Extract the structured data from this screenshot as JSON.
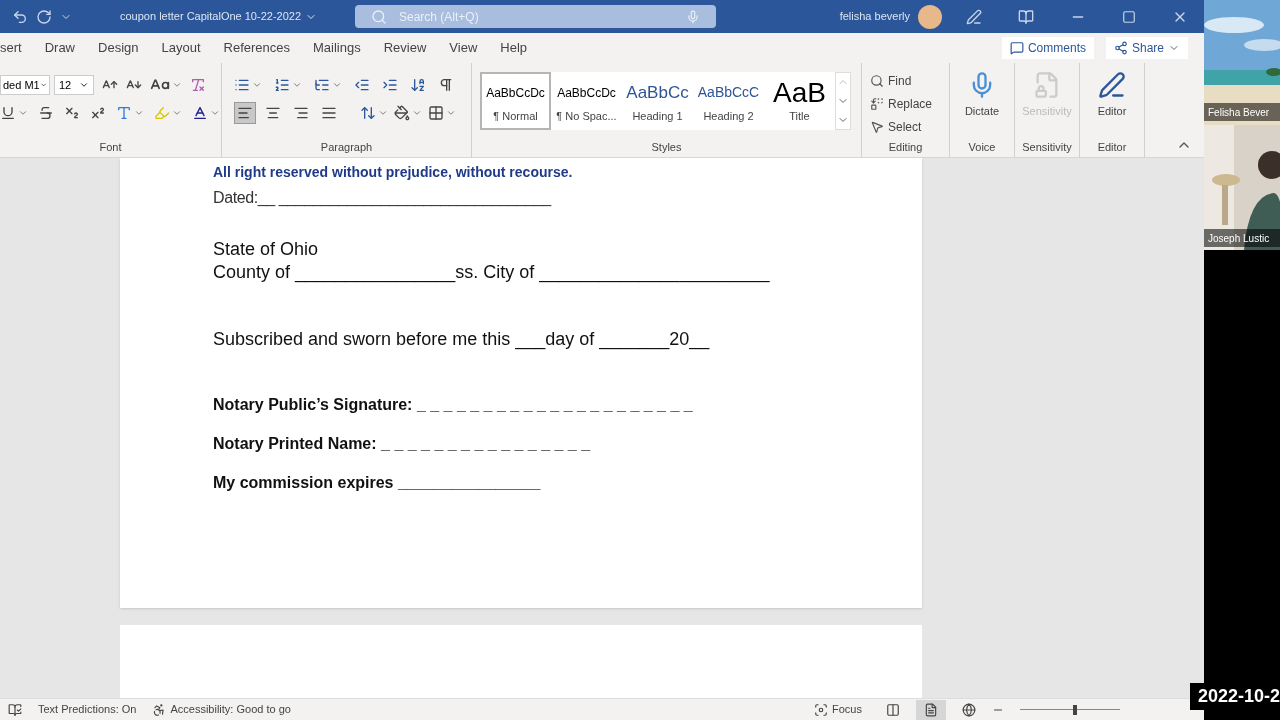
{
  "title_bar": {
    "document_title": "coupon letter CapitalOne 10-22-2022",
    "search_placeholder": "Search (Alt+Q)",
    "user_name": "felisha beverly"
  },
  "ribbon_tabs": [
    {
      "label": "sert",
      "selected": false
    },
    {
      "label": "Draw",
      "selected": false
    },
    {
      "label": "Design",
      "selected": false
    },
    {
      "label": "Layout",
      "selected": false
    },
    {
      "label": "References",
      "selected": false
    },
    {
      "label": "Mailings",
      "selected": false
    },
    {
      "label": "Review",
      "selected": false
    },
    {
      "label": "View",
      "selected": false
    },
    {
      "label": "Help",
      "selected": false
    }
  ],
  "comments_button": "Comments",
  "share_button": "Share",
  "font_group": {
    "font_name": "ded M1",
    "font_size": "12",
    "label": "Font"
  },
  "paragraph_group": {
    "label": "Paragraph",
    "alignments": [
      {
        "kind": "left",
        "selected": true
      },
      {
        "kind": "center",
        "selected": false
      },
      {
        "kind": "right",
        "selected": false
      },
      {
        "kind": "justify",
        "selected": false
      }
    ]
  },
  "styles_group": {
    "label": "Styles",
    "styles": [
      {
        "preview": "AaBbCcDc",
        "name": "¶ Normal",
        "kind": "normal",
        "selected": true
      },
      {
        "preview": "AaBbCcDc",
        "name": "¶ No Spac...",
        "kind": "normal",
        "selected": false
      },
      {
        "preview": "AaBbCc",
        "name": "Heading 1",
        "kind": "heading1",
        "selected": false
      },
      {
        "preview": "AaBbCcC",
        "name": "Heading 2",
        "kind": "heading2",
        "selected": false
      },
      {
        "preview": "AaB",
        "name": "Title",
        "kind": "title",
        "selected": false
      }
    ]
  },
  "editing_group": {
    "label": "Editing",
    "items": [
      {
        "kind": "find",
        "label": "Find"
      },
      {
        "kind": "replace",
        "label": "Replace"
      },
      {
        "kind": "select",
        "label": "Select"
      }
    ]
  },
  "big_buttons": [
    {
      "kind": "dictate",
      "label": "Dictate",
      "group": "Voice",
      "disabled": false
    },
    {
      "kind": "sensitivity",
      "label": "Sensitivity",
      "group": "Sensitivity",
      "disabled": true
    },
    {
      "kind": "editor",
      "label": "Editor",
      "group": "Editor",
      "disabled": false
    }
  ],
  "document": {
    "lines": [
      {
        "kind": "blue_bold",
        "text": "All right reserved without prejudice, without recourse."
      },
      {
        "kind": "dated",
        "text": "Dated:__ ________________________________"
      },
      {
        "kind": "gap"
      },
      {
        "kind": "plain",
        "text": "State of Ohio"
      },
      {
        "kind": "plain",
        "text": "County of ________________ss. City of _______________________"
      },
      {
        "kind": "gap2"
      },
      {
        "kind": "plain",
        "text": "Subscribed and sworn before me this ___day of _______20__"
      },
      {
        "kind": "gap2"
      },
      {
        "kind": "bold",
        "text": "Notary Public’s Signature: _ _ _ _ _ _ _ _ _ _ _ _ _ _ _ _ _ _ _ _ _"
      },
      {
        "kind": "bold",
        "text": "Notary Printed Name: _ _ _ _ _ _ _ _ _ _ _ _ _ _ _ _"
      },
      {
        "kind": "bold",
        "text": "My commission expires ________________"
      }
    ]
  },
  "status_bar": {
    "text_predictions": "Text Predictions: On",
    "accessibility": "Accessibility: Good to go",
    "focus": "Focus",
    "zoom": {
      "level": 0.55
    }
  },
  "video_tiles": [
    {
      "kind": "beach",
      "name": "Felisha Bever"
    },
    {
      "kind": "person",
      "name": "Joseph Lustic"
    }
  ],
  "timestamp": "2022-10-2"
}
